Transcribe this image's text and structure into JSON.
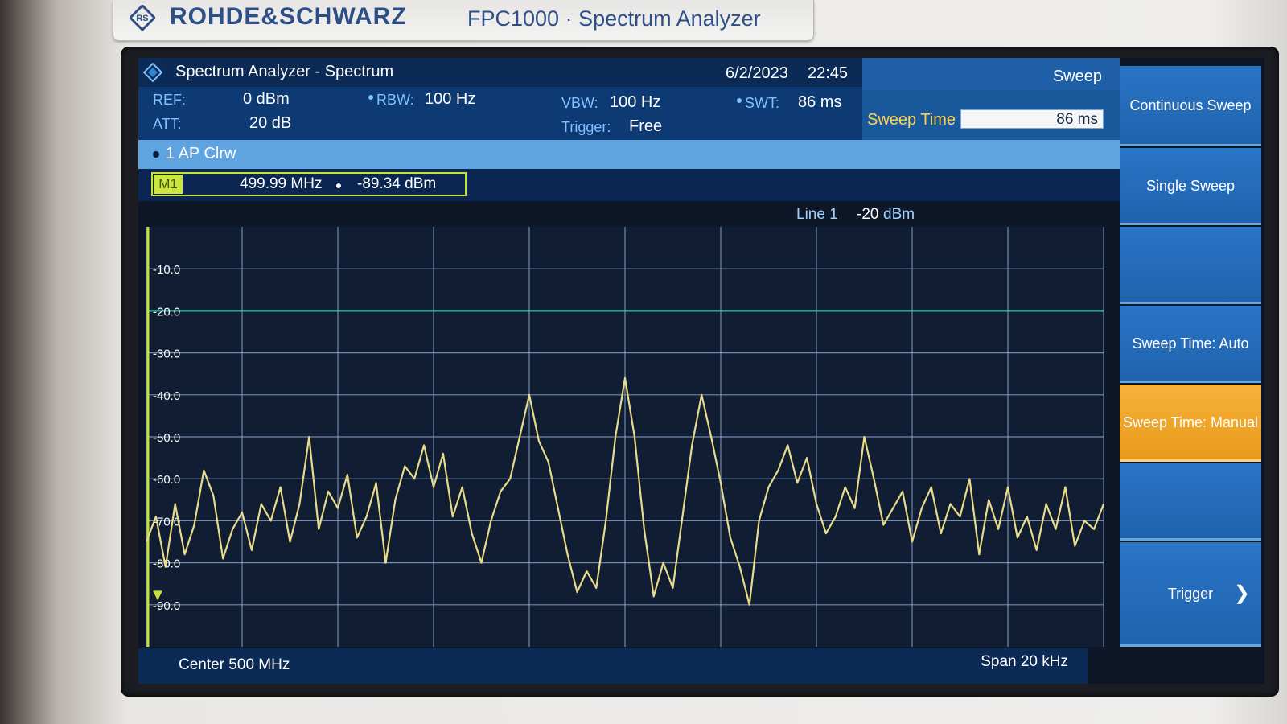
{
  "device": {
    "brand": "ROHDE&SCHWARZ",
    "model": "FPC1000 · Spectrum Analyzer",
    "logo_icon": "rs-diamond-logo"
  },
  "header": {
    "title": "Spectrum Analyzer - Spectrum",
    "date": "6/2/2023",
    "time": "22:45"
  },
  "params": {
    "ref_label": "REF:",
    "ref_value": "0 dBm",
    "att_label": "ATT:",
    "att_value": "20 dB",
    "rbw_label": "RBW:",
    "rbw_value": "100 Hz",
    "vbw_label": "VBW:",
    "vbw_value": "100 Hz",
    "trigger_label": "Trigger:",
    "trigger_value": "Free",
    "swt_label": "SWT:",
    "swt_value": "86 ms"
  },
  "sweep_panel": {
    "title": "Sweep",
    "edit_label": "Sweep Time",
    "edit_value": "86 ms"
  },
  "trace": {
    "label": "1 AP Clrw"
  },
  "marker": {
    "tag": "M1",
    "frequency": "499.99 MHz",
    "level": "-89.34 dBm"
  },
  "display_line": {
    "label": "Line 1",
    "value": "-20",
    "unit": "dBm",
    "level_dbm": -20
  },
  "footer": {
    "center": "Center 500 MHz",
    "span": "Span 20 kHz"
  },
  "softkeys": [
    {
      "label": "Continuous Sweep",
      "active": false
    },
    {
      "label": "Single Sweep",
      "active": false
    },
    {
      "label": "",
      "active": false
    },
    {
      "label": "Sweep Time: Auto",
      "active": false
    },
    {
      "label": "Sweep Time: Manual",
      "active": true
    },
    {
      "label": "",
      "active": false
    },
    {
      "label": "Trigger",
      "active": false,
      "chevron": "❯"
    }
  ],
  "colors": {
    "trace": "#e8dc8a",
    "display_line": "#4fd6c8",
    "grid": "#8fb0d8",
    "active_softkey": "#f0a62a"
  },
  "chart_data": {
    "type": "line",
    "title": "",
    "xlabel": "",
    "ylabel": "",
    "x_range_hz": [
      499990000,
      500010000
    ],
    "ylim": [
      -100,
      0
    ],
    "y_ticks": [
      "-10.0",
      "-20.0",
      "-30.0",
      "-40.0",
      "-50.0",
      "-60.0",
      "-70.0",
      "-80.0",
      "-90.0"
    ],
    "y_tick_values": [
      -10,
      -20,
      -30,
      -40,
      -50,
      -60,
      -70,
      -80,
      -90
    ],
    "grid": true,
    "series": [
      {
        "x_khz_offset": [
          -10.0,
          -9.8,
          -9.6,
          -9.4,
          -9.2,
          -9.0,
          -8.8,
          -8.6,
          -8.4,
          -8.2,
          -8.0,
          -7.8,
          -7.6,
          -7.4,
          -7.2,
          -7.0,
          -6.8,
          -6.6,
          -6.4,
          -6.2,
          -6.0,
          -5.8,
          -5.6,
          -5.4,
          -5.2,
          -5.0,
          -4.8,
          -4.6,
          -4.4,
          -4.2,
          -4.0,
          -3.8,
          -3.6,
          -3.4,
          -3.2,
          -3.0,
          -2.8,
          -2.6,
          -2.4,
          -2.2,
          -2.0,
          -1.8,
          -1.6,
          -1.4,
          -1.2,
          -1.0,
          -0.8,
          -0.6,
          -0.4,
          -0.2,
          0.0,
          0.2,
          0.4,
          0.6,
          0.8,
          1.0,
          1.2,
          1.4,
          1.6,
          1.8,
          2.0,
          2.2,
          2.4,
          2.6,
          2.8,
          3.0,
          3.2,
          3.4,
          3.6,
          3.8,
          4.0,
          4.2,
          4.4,
          4.6,
          4.8,
          5.0,
          5.2,
          5.4,
          5.6,
          5.8,
          6.0,
          6.2,
          6.4,
          6.6,
          6.8,
          7.0,
          7.2,
          7.4,
          7.6,
          7.8,
          8.0,
          8.2,
          8.4,
          8.6,
          8.8,
          9.0,
          9.2,
          9.4,
          9.6,
          9.8,
          10.0
        ],
        "y": [
          -75,
          -69,
          -81,
          -66,
          -78,
          -71,
          -58,
          -64,
          -79,
          -72,
          -68,
          -77,
          -66,
          -70,
          -62,
          -75,
          -66,
          -50,
          -72,
          -63,
          -67,
          -59,
          -74,
          -69,
          -61,
          -80,
          -65,
          -57,
          -60,
          -52,
          -62,
          -54,
          -69,
          -62,
          -73,
          -80,
          -70,
          -63,
          -60,
          -50,
          -40,
          -51,
          -56,
          -67,
          -78,
          -87,
          -82,
          -86,
          -70,
          -50,
          -36,
          -50,
          -72,
          -88,
          -80,
          -86,
          -69,
          -52,
          -40,
          -50,
          -61,
          -74,
          -81,
          -90,
          -70,
          -62,
          -58,
          -52,
          -61,
          -55,
          -66,
          -73,
          -69,
          -62,
          -67,
          -50,
          -60,
          -71,
          -67,
          -63,
          -75,
          -67,
          -62,
          -73,
          -66,
          -69,
          -60,
          -78,
          -65,
          -72,
          -62,
          -74,
          -69,
          -77,
          -66,
          -72,
          -62,
          -76,
          -70,
          -72,
          -66
        ]
      }
    ]
  }
}
